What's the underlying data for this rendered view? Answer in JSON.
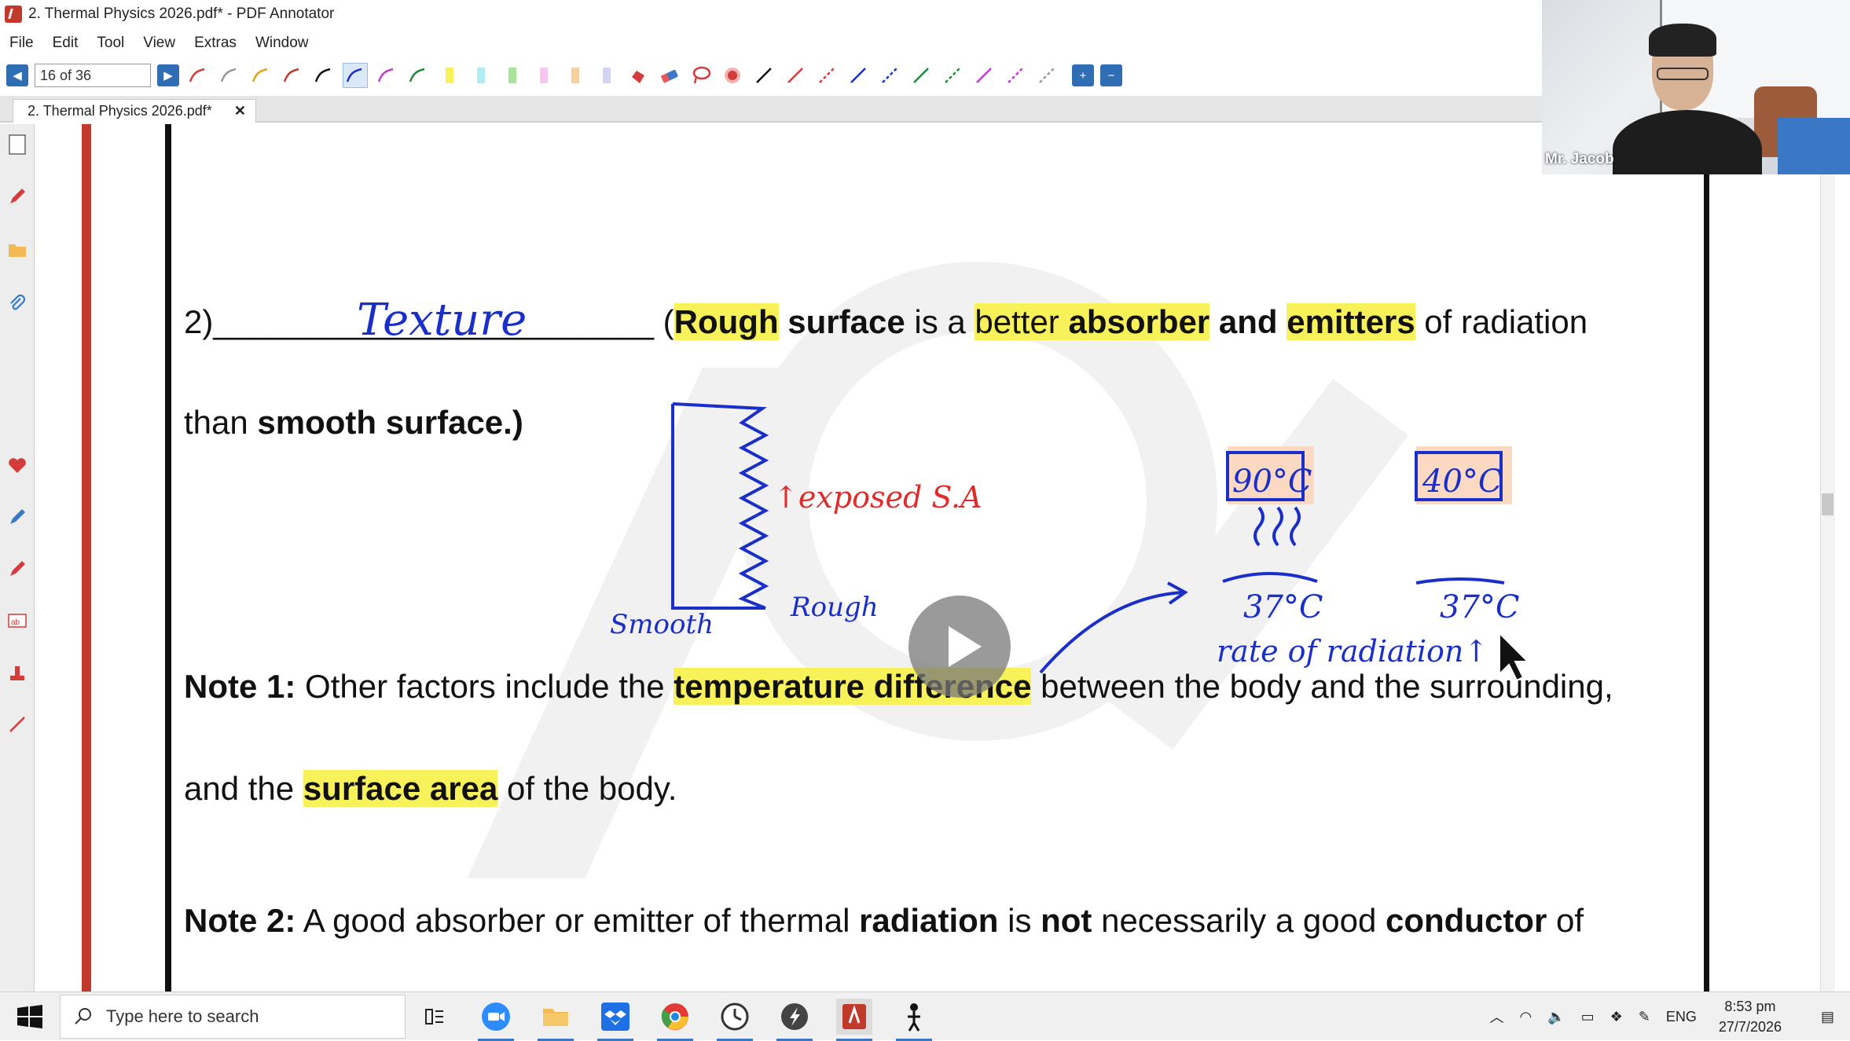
{
  "window": {
    "title": "2. Thermal Physics 2026.pdf* - PDF Annotator"
  },
  "menu": [
    "File",
    "Edit",
    "Tool",
    "View",
    "Extras",
    "Window"
  ],
  "toolbar": {
    "page_indicator": "16 of 36",
    "prev_label": "◀",
    "next_label": "▶",
    "zoom_in": "+",
    "zoom_out": "−"
  },
  "tab": {
    "label": "2. Thermal Physics 2026.pdf*",
    "close": "✕"
  },
  "document": {
    "line1": {
      "prefix": "2)",
      "blank": "________________________",
      "paren_open": "(",
      "rough": "Rough",
      "surface_word": "surface",
      "is_a": "is a",
      "better": "better",
      "absorber": "absorber",
      "and": "and",
      "emitters": "emitters",
      "of_radiation": "of radiation"
    },
    "line2": {
      "than": "than",
      "smooth_surface": "smooth surface.)"
    },
    "note1": {
      "label": "Note 1:",
      "text_a": "Other factors include the",
      "temp_diff": "temperature difference",
      "text_b": "between the body and the surrounding,"
    },
    "note1b": {
      "and_the": "and the",
      "surface_area": "surface area",
      "of_the_body": "of the body."
    },
    "note2": {
      "label": "Note 2:",
      "text_a": "A good absorber or emitter of thermal",
      "radiation": "radiation",
      "is": "is",
      "not": "not",
      "text_b": "necessarily a good",
      "conductor": "conductor",
      "of": "of"
    }
  },
  "annotations": {
    "texture": "Texture",
    "exposed_sa": "↑exposed S.A",
    "smooth": "Smooth",
    "rough": "Rough",
    "temp_hot": "90°C",
    "temp_warm": "40°C",
    "body_temp_1": "37°C",
    "body_temp_2": "37°C",
    "rate_of_radiation": "rate of radiation↑"
  },
  "webcam": {
    "name": "Mr. Jacob"
  },
  "taskbar": {
    "search_placeholder": "Type here to search",
    "language": "ENG",
    "time": "8:53 pm",
    "date": "27/7/2026"
  },
  "colors": {
    "highlight": "#f7f15a",
    "ink_blue": "#1a2fc9",
    "ink_red": "#e02b2b",
    "app_red": "#c0392b",
    "accent_blue": "#2f6db5"
  }
}
